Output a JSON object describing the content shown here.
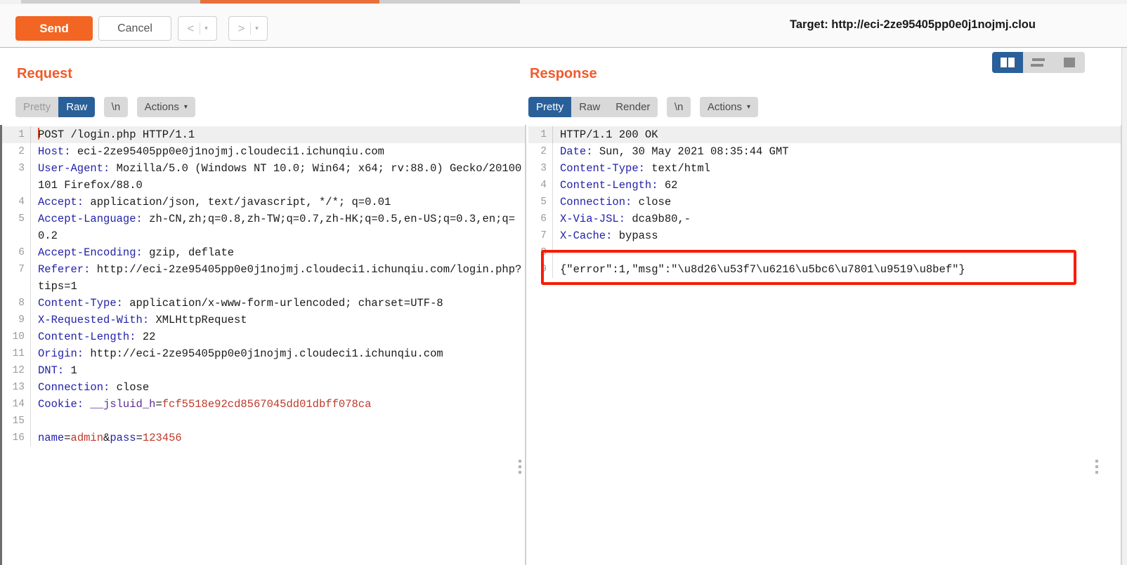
{
  "app": {
    "target_label": "Target: http://eci-2ze95405pp0e0j1nojmj.clou"
  },
  "toolbar": {
    "send_label": "Send",
    "cancel_label": "Cancel",
    "prev_arrow": "<",
    "next_arrow": ">",
    "caret": "▾"
  },
  "request": {
    "title": "Request",
    "tabs": [
      {
        "label": "Pretty",
        "active": false
      },
      {
        "label": "Raw",
        "active": true
      },
      {
        "label": "\\n",
        "active": false
      },
      {
        "label": "Actions",
        "active": false
      }
    ],
    "lines": [
      {
        "n": "1",
        "segments": [
          {
            "t": "POST /login.php HTTP/1.1",
            "c": "plain"
          }
        ]
      },
      {
        "n": "2",
        "segments": [
          {
            "t": "Host: ",
            "c": "hk"
          },
          {
            "t": "eci-2ze95405pp0e0j1nojmj.cloudeci1.ichunqiu.com",
            "c": "hv"
          }
        ]
      },
      {
        "n": "3",
        "segments": [
          {
            "t": "User-Agent: ",
            "c": "hk"
          },
          {
            "t": "Mozilla/5.0 (Windows NT 10.0; Win64; x64; rv:88.0) Gecko/20100101 Firefox/88.0",
            "c": "hv"
          }
        ]
      },
      {
        "n": "4",
        "segments": [
          {
            "t": "Accept: ",
            "c": "hk"
          },
          {
            "t": "application/json, text/javascript, */*; q=0.01",
            "c": "hv"
          }
        ]
      },
      {
        "n": "5",
        "segments": [
          {
            "t": "Accept-Language: ",
            "c": "hk"
          },
          {
            "t": "zh-CN,zh;q=0.8,zh-TW;q=0.7,zh-HK;q=0.5,en-US;q=0.3,en;q=0.2",
            "c": "hv"
          }
        ]
      },
      {
        "n": "6",
        "segments": [
          {
            "t": "Accept-Encoding: ",
            "c": "hk"
          },
          {
            "t": "gzip, deflate",
            "c": "hv"
          }
        ]
      },
      {
        "n": "7",
        "segments": [
          {
            "t": "Referer: ",
            "c": "hk"
          },
          {
            "t": "http://eci-2ze95405pp0e0j1nojmj.cloudeci1.ichunqiu.com/login.php?tips=1",
            "c": "hv"
          }
        ]
      },
      {
        "n": "8",
        "segments": [
          {
            "t": "Content-Type: ",
            "c": "hk"
          },
          {
            "t": "application/x-www-form-urlencoded; charset=UTF-8",
            "c": "hv"
          }
        ]
      },
      {
        "n": "9",
        "segments": [
          {
            "t": "X-Requested-With: ",
            "c": "hk"
          },
          {
            "t": "XMLHttpRequest",
            "c": "hv"
          }
        ]
      },
      {
        "n": "10",
        "segments": [
          {
            "t": "Content-Length: ",
            "c": "hk"
          },
          {
            "t": "22",
            "c": "hv"
          }
        ]
      },
      {
        "n": "11",
        "segments": [
          {
            "t": "Origin: ",
            "c": "hk"
          },
          {
            "t": "http://eci-2ze95405pp0e0j1nojmj.cloudeci1.ichunqiu.com",
            "c": "hv"
          }
        ]
      },
      {
        "n": "12",
        "segments": [
          {
            "t": "DNT: ",
            "c": "hk"
          },
          {
            "t": "1",
            "c": "hv"
          }
        ]
      },
      {
        "n": "13",
        "segments": [
          {
            "t": "Connection: ",
            "c": "hk"
          },
          {
            "t": "close",
            "c": "hv"
          }
        ]
      },
      {
        "n": "14",
        "segments": [
          {
            "t": "Cookie: ",
            "c": "hk"
          },
          {
            "t": "__jsluid_h",
            "c": "pl"
          },
          {
            "t": "=",
            "c": "plain"
          },
          {
            "t": "fcf5518e92cd8567045dd01dbff078ca",
            "c": "rd"
          }
        ]
      },
      {
        "n": "15",
        "segments": [
          {
            "t": "",
            "c": "plain"
          }
        ]
      },
      {
        "n": "16",
        "segments": [
          {
            "t": "name",
            "c": "hk"
          },
          {
            "t": "=",
            "c": "plain"
          },
          {
            "t": "admin",
            "c": "rd"
          },
          {
            "t": "&",
            "c": "plain"
          },
          {
            "t": "pass",
            "c": "hk"
          },
          {
            "t": "=",
            "c": "plain"
          },
          {
            "t": "123456",
            "c": "rd"
          }
        ]
      }
    ]
  },
  "response": {
    "title": "Response",
    "tabs": [
      {
        "label": "Pretty",
        "active": true
      },
      {
        "label": "Raw",
        "active": false
      },
      {
        "label": "Render",
        "active": false
      },
      {
        "label": "\\n",
        "active": false
      },
      {
        "label": "Actions",
        "active": false
      }
    ],
    "lines": [
      {
        "n": "1",
        "segments": [
          {
            "t": "HTTP/1.1 200 OK",
            "c": "plain"
          }
        ]
      },
      {
        "n": "2",
        "segments": [
          {
            "t": "Date: ",
            "c": "hk"
          },
          {
            "t": "Sun, 30 May 2021 08:35:44 GMT",
            "c": "hv"
          }
        ]
      },
      {
        "n": "3",
        "segments": [
          {
            "t": "Content-Type: ",
            "c": "hk"
          },
          {
            "t": "text/html",
            "c": "hv"
          }
        ]
      },
      {
        "n": "4",
        "segments": [
          {
            "t": "Content-Length: ",
            "c": "hk"
          },
          {
            "t": "62",
            "c": "hv"
          }
        ]
      },
      {
        "n": "5",
        "segments": [
          {
            "t": "Connection: ",
            "c": "hk"
          },
          {
            "t": "close",
            "c": "hv"
          }
        ]
      },
      {
        "n": "6",
        "segments": [
          {
            "t": "X-Via-JSL: ",
            "c": "hk"
          },
          {
            "t": "dca9b80,-",
            "c": "hv"
          }
        ]
      },
      {
        "n": "7",
        "segments": [
          {
            "t": "X-Cache: ",
            "c": "hk"
          },
          {
            "t": "bypass",
            "c": "hv"
          }
        ]
      },
      {
        "n": "8",
        "segments": [
          {
            "t": "",
            "c": "plain"
          }
        ]
      },
      {
        "n": "9",
        "segments": [
          {
            "t": "{\"error\":1,\"msg\":\"\\u8d26\\u53f7\\u6216\\u5bc6\\u7801\\u9519\\u8bef\"}",
            "c": "plain"
          }
        ]
      }
    ]
  },
  "layout_toggle": {
    "options": [
      {
        "name": "side-by-side",
        "active": true
      },
      {
        "name": "stacked",
        "active": false
      },
      {
        "name": "single-pane",
        "active": false
      }
    ]
  },
  "colors": {
    "accent_orange": "#f26522",
    "panel_title": "#f15a29",
    "tab_active_blue": "#2a6099",
    "annotation_red": "#f81b02",
    "header_key_blue": "#2222aa",
    "value_red": "#c0392b",
    "cookie_purple": "#5c2d91"
  }
}
